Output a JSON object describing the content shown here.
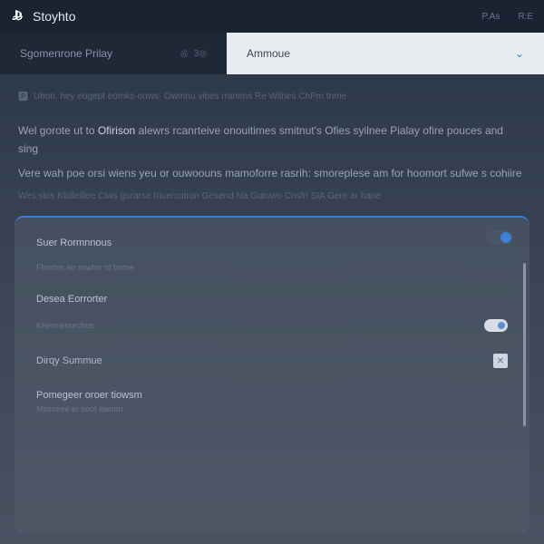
{
  "header": {
    "appTitle": "Stoyhto",
    "rightItem1": "P.As",
    "rightItem2": "R:E"
  },
  "tabs": {
    "left": {
      "label": "Sgomenrone Prilay",
      "badge1": "◎",
      "badge2": "3◎"
    },
    "active": {
      "label": "Ammoue"
    }
  },
  "hint": {
    "text": "Ubon. hey eogept eomks·ouws· Owmnu vibes rramms Re Wilnes ChPm tnme"
  },
  "body": {
    "line1a": "Wel gorote ut to ",
    "line1highlight": "Ofirison",
    "line1b": " alewrs rcanrteive onouitimes smitnut's Ofies syilnee Pialay ofire pouces and sing",
    "line2": "Vere wah poe orsi wiens yeu or ouwoouns mamoforre rasrih: smoreplese am for hoomort sufwe s cohiire",
    "mutedLine": "Wes slos Klidleillee Ciws gurarse Inuercutron Gesend Na Gurowo Cnsfn SIA Gere ar hane"
  },
  "dialog": {
    "section1": {
      "title": "Suer Rormnnous",
      "sub": "Fhmhm ao sowhrr nf bome"
    },
    "section2": {
      "title": "Desea Eorrorter",
      "sub": "Khermenurchos"
    },
    "section3": {
      "title": "Dirqy Summue"
    },
    "section4": {
      "title": "Pomegeer oroer tiowsm",
      "sub": "Mosseee er soot ewnon"
    }
  }
}
